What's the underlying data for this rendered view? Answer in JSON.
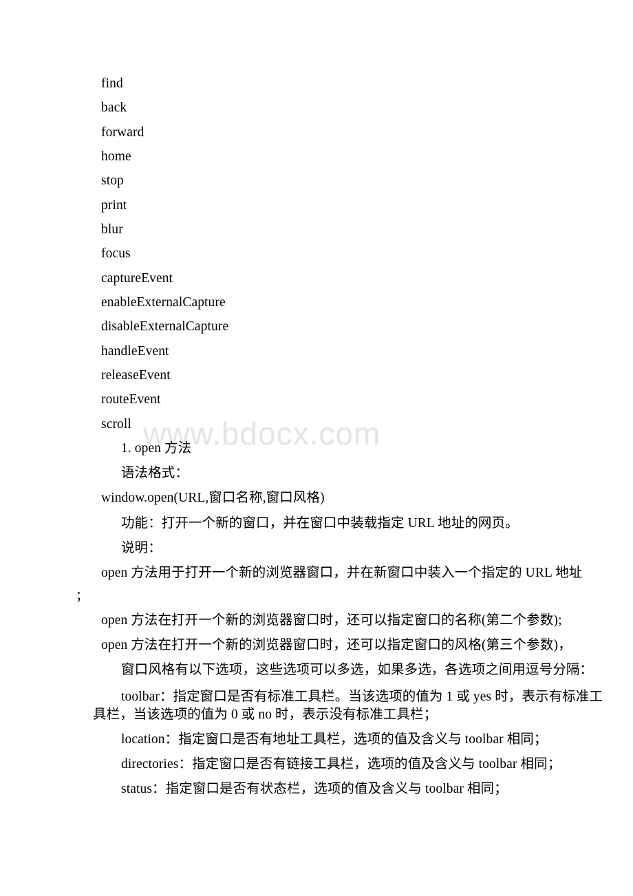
{
  "document": {
    "watermark": "www.bdocx.com",
    "method_list": [
      "find",
      "back",
      "forward",
      "home",
      "stop",
      "print",
      "blur",
      "focus",
      "captureEvent",
      "enableExternalCapture",
      "disableExternalCapture",
      "handleEvent",
      "releaseEvent",
      "routeEvent",
      "scroll"
    ],
    "section": {
      "heading": "1. open 方法",
      "syntax_label": "语法格式：",
      "syntax_code": "window.open(URL,窗口名称,窗口风格)",
      "function_label": "功能：打开一个新的窗口，并在窗口中装载指定 URL 地址的网页。",
      "description_label": "说明：",
      "paragraph_1_line_1": "open 方法用于打开一个新的浏览器窗口，并在新窗口中装入一个指定的 URL 地址",
      "paragraph_1_line_2": "；",
      "paragraph_2": "open 方法在打开一个新的浏览器窗口时，还可以指定窗口的名称(第二个参数);",
      "paragraph_3": "open 方法在打开一个新的浏览器窗口时，还可以指定窗口的风格(第三个参数)，",
      "paragraph_4": "窗口风格有以下选项，这些选项可以多选，如果多选，各选项之间用逗号分隔：",
      "option_toolbar_line_1": "toolbar：指定窗口是否有标准工具栏。当该选项的值为 1 或 yes 时，表示有标准工",
      "option_toolbar_line_2": "具栏，当该选项的值为 0 或 no 时，表示没有标准工具栏；",
      "option_location": "location：指定窗口是否有地址工具栏，选项的值及含义与 toolbar 相同；",
      "option_directories": "directories：指定窗口是否有链接工具栏，选项的值及含义与 toolbar 相同；",
      "option_status": "status：指定窗口是否有状态栏，选项的值及含义与 toolbar 相同；"
    }
  }
}
